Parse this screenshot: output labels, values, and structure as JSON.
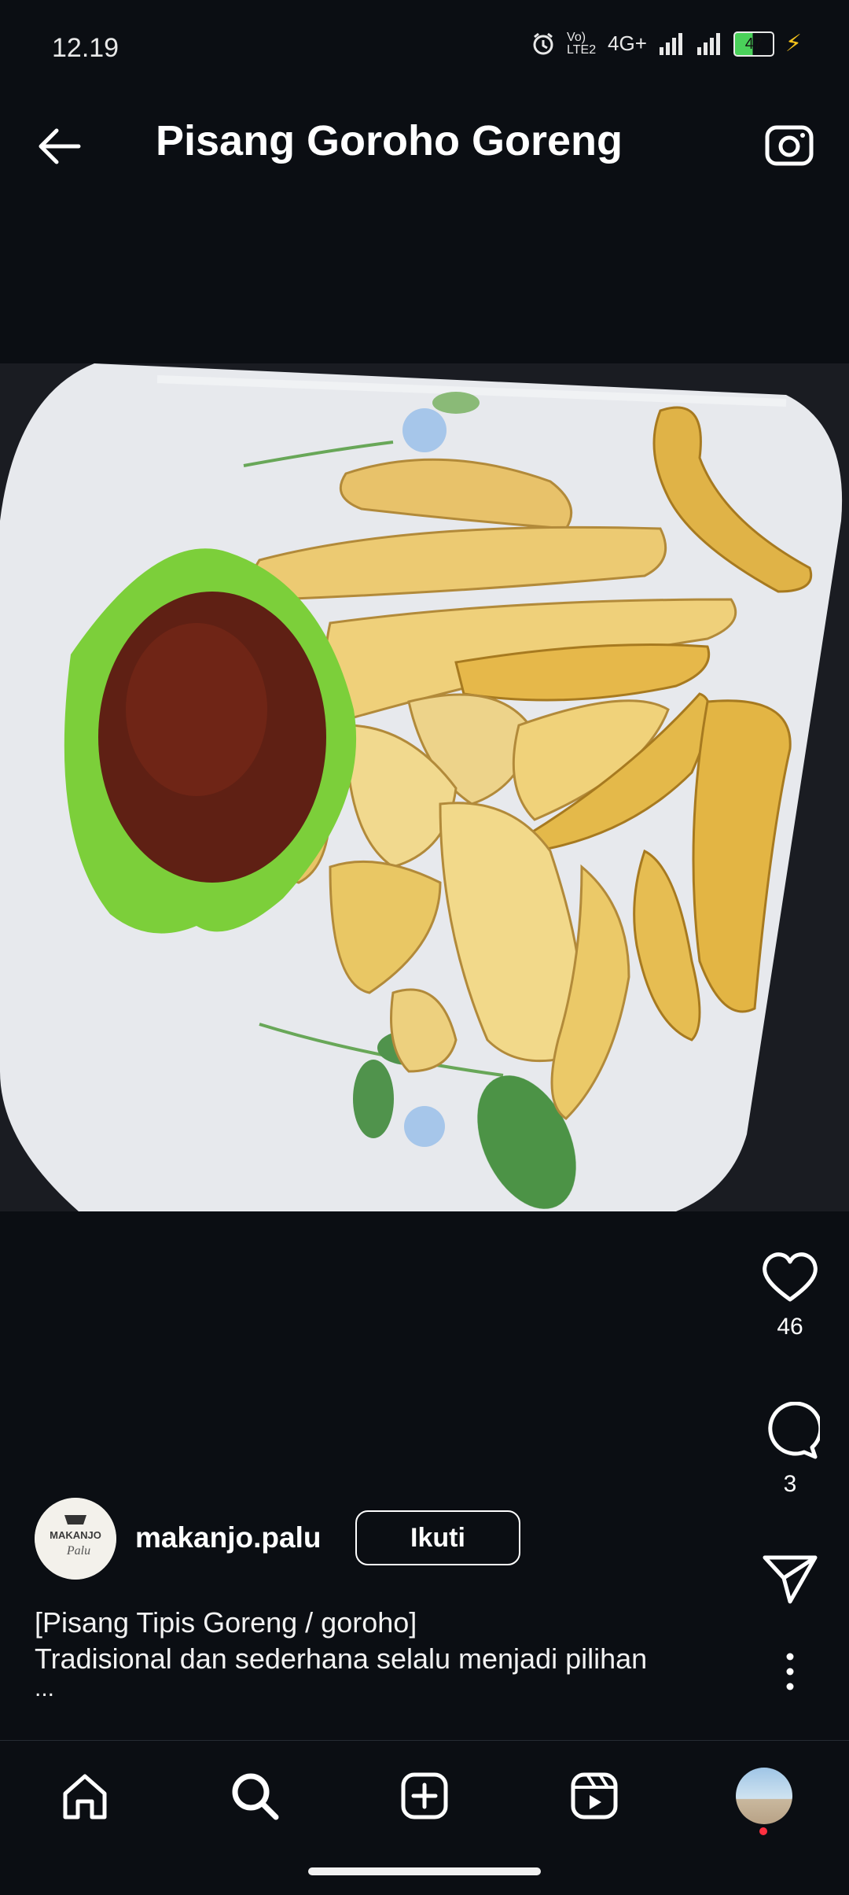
{
  "status": {
    "time": "12.19",
    "network": "4G+",
    "battery": "47",
    "volte": "Vo) LTE2"
  },
  "header": {
    "title": "Pisang Goroho Goreng"
  },
  "post": {
    "likes": "46",
    "comments": "3",
    "username": "makanjo.palu",
    "follow_label": "Ikuti",
    "caption_line1": "[Pisang Tipis Goreng / goroho]",
    "caption_line2": "Tradisional dan sederhana selalu menjadi pilihan",
    "caption_more": "...",
    "avatar_text": "MAKANJO",
    "avatar_script": "Palu"
  },
  "icons": {
    "back": "arrow-left-icon",
    "camera": "camera-icon",
    "like": "heart-icon",
    "comment": "comment-icon",
    "share": "send-icon",
    "more": "more-vertical-icon",
    "home": "home-icon",
    "search": "search-icon",
    "create": "plus-square-icon",
    "reels": "reels-icon"
  },
  "colors": {
    "background": "#0b0e13",
    "text": "#ffffff",
    "notification_dot": "#ff3040"
  }
}
